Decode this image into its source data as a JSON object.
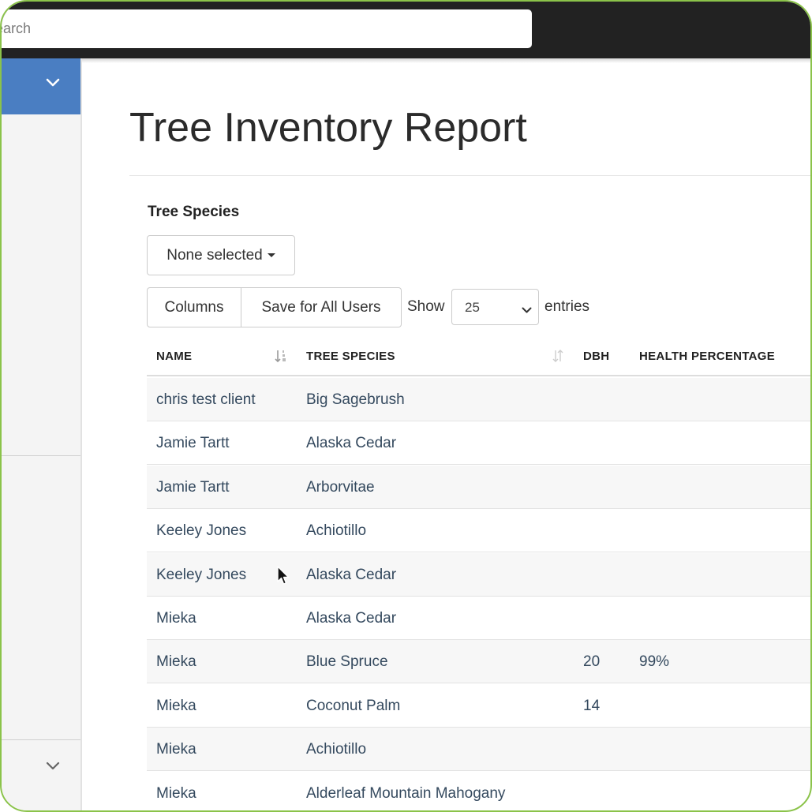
{
  "search": {
    "placeholder": "earch"
  },
  "page": {
    "title": "Tree Inventory Report"
  },
  "filter": {
    "label": "Tree Species",
    "dropdown_label": "None selected"
  },
  "toolbar": {
    "columns_label": "Columns",
    "save_label": "Save for All Users",
    "show_label": "Show",
    "page_size": "25",
    "entries_label": "entries"
  },
  "table": {
    "headers": {
      "name": "NAME",
      "species": "TREE SPECIES",
      "dbh": "DBH",
      "health": "HEALTH PERCENTAGE"
    },
    "rows": [
      {
        "name": "chris test client",
        "species": "Big Sagebrush",
        "dbh": "",
        "health": ""
      },
      {
        "name": "Jamie Tartt",
        "species": "Alaska Cedar",
        "dbh": "",
        "health": ""
      },
      {
        "name": "Jamie Tartt",
        "species": "Arborvitae",
        "dbh": "",
        "health": ""
      },
      {
        "name": "Keeley Jones",
        "species": "Achiotillo",
        "dbh": "",
        "health": ""
      },
      {
        "name": "Keeley Jones",
        "species": "Alaska Cedar",
        "dbh": "",
        "health": ""
      },
      {
        "name": "Mieka",
        "species": "Alaska Cedar",
        "dbh": "",
        "health": ""
      },
      {
        "name": "Mieka",
        "species": "Blue Spruce",
        "dbh": "20",
        "health": "99%"
      },
      {
        "name": "Mieka",
        "species": "Coconut Palm",
        "dbh": "14",
        "health": ""
      },
      {
        "name": "Mieka",
        "species": "Achiotillo",
        "dbh": "",
        "health": ""
      },
      {
        "name": "Mieka",
        "species": "Alderleaf Mountain Mahogany",
        "dbh": "",
        "health": ""
      }
    ]
  },
  "icons": {
    "sidebar_toggle": "chevron-down-icon",
    "sidebar_bottom": "chevron-down-icon",
    "sort": "sort-icon",
    "cursor": "mouse-pointer-icon"
  },
  "colors": {
    "topbar": "#222222",
    "sidebar_accent": "#4a7ec2",
    "frame_border": "#8bc34a",
    "cell_text": "#34495e"
  }
}
